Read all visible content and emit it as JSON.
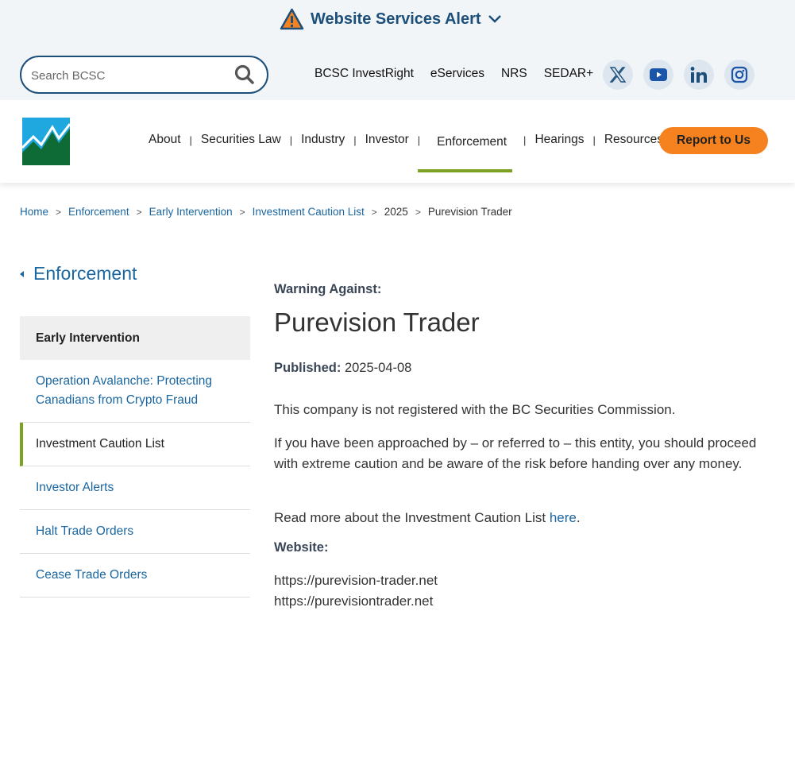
{
  "alert": {
    "label": "Website Services Alert"
  },
  "search": {
    "placeholder": "Search BCSC"
  },
  "top_links": [
    "BCSC InvestRight",
    "eServices",
    "NRS",
    "SEDAR+"
  ],
  "social_icons": [
    "x-twitter-icon",
    "youtube-icon",
    "linkedin-icon",
    "instagram-icon"
  ],
  "nav": {
    "items": [
      "About",
      "Securities Law",
      "Industry",
      "Investor",
      "Enforcement",
      "Hearings",
      "Resources"
    ],
    "active": "Enforcement",
    "report_button": "Report to Us"
  },
  "breadcrumb": {
    "links": [
      "Home",
      "Enforcement",
      "Early Intervention",
      "Investment Caution List"
    ],
    "plain": [
      "2025",
      "Purevision Trader"
    ]
  },
  "sidebar": {
    "back_label": "Enforcement",
    "items": [
      "Early Intervention",
      "Operation Avalanche: Protecting Canadians from Crypto Fraud",
      "Investment Caution List",
      "Investor Alerts",
      "Halt Trade Orders",
      "Cease Trade Orders"
    ]
  },
  "main": {
    "warning_label": "Warning Against:",
    "title": "Purevision Trader",
    "published_label": "Published:",
    "published_date": "2025-04-08",
    "para1": "This company is not registered with the BC Securities Commission.",
    "para2": "If you have been approached by – or referred to – this entity, you should proceed with extreme caution and be aware of the risk before handing over any money.",
    "para3_prefix": "Read more about the Investment Caution List ",
    "para3_link": "here",
    "para3_suffix": ".",
    "website_label": "Website:",
    "websites": [
      "https://purevision-trader.net",
      "https://purevisiontrader.net"
    ]
  },
  "colors": {
    "brand_blue": "#1c4f7a",
    "link_blue": "#1a66a0",
    "accent_green": "#7ba321",
    "report_orange": "#f5821f"
  }
}
